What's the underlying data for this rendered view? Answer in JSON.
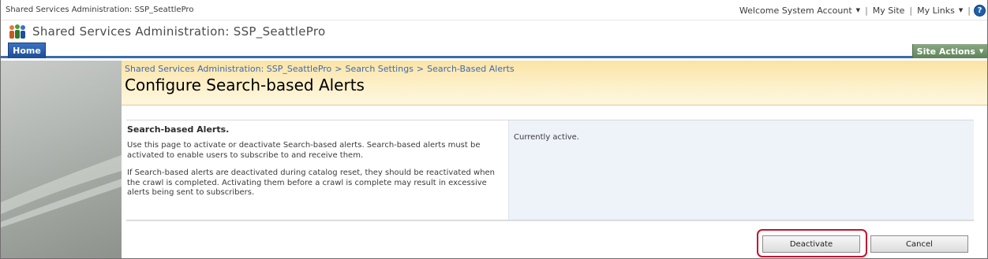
{
  "global_bar": {
    "site_name": "Shared Services Administration: SSP_SeattlePro",
    "welcome": "Welcome System Account",
    "my_site": "My Site",
    "my_links": "My Links",
    "help_icon": "?"
  },
  "header": {
    "title": "Shared Services Administration: SSP_SeattlePro"
  },
  "nav": {
    "home_tab": "Home",
    "site_actions": "Site Actions"
  },
  "breadcrumb": [
    "Shared Services Administration: SSP_SeattlePro",
    "Search Settings",
    "Search-Based Alerts"
  ],
  "page": {
    "title": "Configure Search-based Alerts"
  },
  "section": {
    "heading": "Search-based Alerts.",
    "paragraph1": "Use this page to activate or deactivate Search-based alerts. Search-based alerts must be activated to enable users to subscribe to and receive them.",
    "paragraph2": "If Search-based alerts are deactivated during catalog reset, they should be reactivated when the crawl is completed. Activating them before a crawl is complete may result in excessive alerts being sent to subscribers.",
    "status": "Currently active."
  },
  "buttons": {
    "deactivate": "Deactivate",
    "cancel": "Cancel"
  },
  "colors": {
    "accent": "#3b6ca8",
    "site_actions": "#6b8f66",
    "title_area": "#fbe3a4",
    "highlight": "#c8102e"
  }
}
